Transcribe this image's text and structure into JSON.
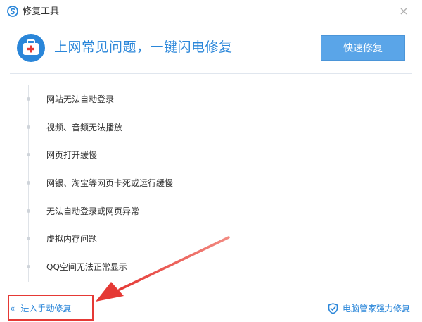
{
  "window": {
    "title": "修复工具",
    "close_glyph": "×",
    "logo_icon": "sogou-browser-logo-icon"
  },
  "header": {
    "headline": "上网常见问题，一键闪电修复",
    "quick_fix_label": "快速修复",
    "icon": "first-aid-kit-icon",
    "accent_color": "#2a86d9",
    "button_color": "#5aa5e8"
  },
  "issues": [
    "网站无法自动登录",
    "视频、音频无法播放",
    "网页打开缓慢",
    "网银、淘宝等网页卡死或运行缓慢",
    "无法自动登录或网页异常",
    "虚拟内存问题",
    "QQ空间无法正常显示"
  ],
  "footer": {
    "manual_repair_label": "进入手动修复",
    "manual_chevron": "«",
    "pc_manager_label": "电脑管家强力修复",
    "pc_manager_icon": "shield-check-icon",
    "annotation_color": "#e53935"
  }
}
